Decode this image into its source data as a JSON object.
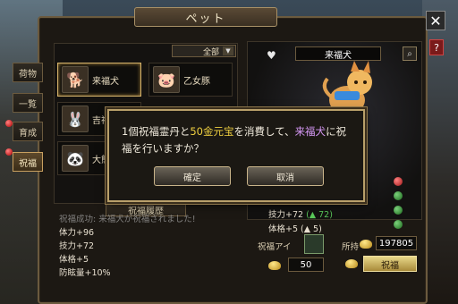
{
  "window": {
    "title": "ペット"
  },
  "controls": {
    "close": "✕",
    "help": "?"
  },
  "side_tabs": [
    {
      "label": "荷物"
    },
    {
      "label": "一覧"
    },
    {
      "label": "育成"
    },
    {
      "label": "祝福"
    }
  ],
  "filter": {
    "selected": "全部"
  },
  "pets": [
    {
      "name": "来福犬",
      "icon": "dog-icon"
    },
    {
      "name": "乙女豚",
      "icon": "pig-icon"
    },
    {
      "name": "吉祥",
      "icon": "rabbit-icon"
    },
    {
      "name": "大熊",
      "icon": "panda-icon"
    }
  ],
  "history": {
    "title": "祝福履歴",
    "lines": [
      "祝福成功: 来福犬が祝福されました!",
      "体力+96",
      "技力+72",
      "体格+5",
      "防眩量+10%"
    ]
  },
  "detail": {
    "pet_name": "来福犬",
    "stats": [
      {
        "label": "技力+72",
        "up": "(▲ 72)"
      },
      {
        "label": "体格+5 (▲ 5)",
        "up": ""
      }
    ]
  },
  "bless": {
    "item_label": "祝福アイ",
    "owned_label": "所持",
    "owned_value": "197805",
    "cost_value": "50",
    "button": "祝福"
  },
  "dialog": {
    "part1": "1個祝福霊丹と",
    "gold": "50金元宝",
    "part2": "を消費して、",
    "pet": "来福犬",
    "part3": "に祝",
    "line2": "福を行いますか？",
    "confirm": "確定",
    "cancel": "取消"
  }
}
